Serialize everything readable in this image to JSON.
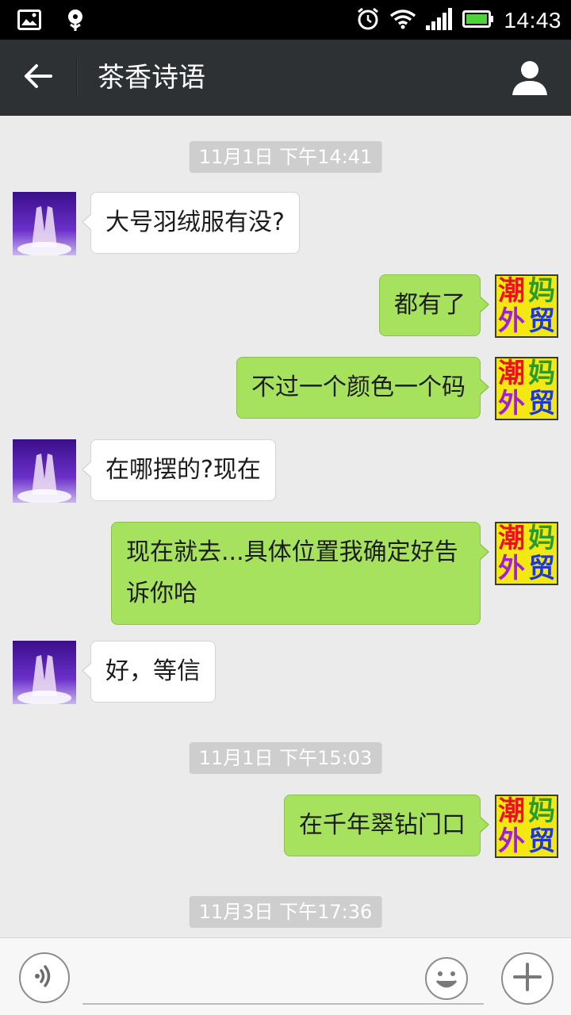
{
  "status_bar": {
    "time": "14:43",
    "left_icons": [
      "image-icon",
      "notification-flower-icon"
    ],
    "right_icons": [
      "alarm-icon",
      "wifi-icon",
      "signal-icon",
      "battery-icon"
    ]
  },
  "header": {
    "title": "茶香诗语",
    "back_icon": "back-arrow-icon",
    "profile_icon": "contact-profile-icon"
  },
  "timestamps": [
    "11月1日 下午14:41",
    "11月1日 下午15:03",
    "11月3日 下午17:36"
  ],
  "messages": [
    {
      "direction": "in",
      "text": "大号羽绒服有没?"
    },
    {
      "direction": "out",
      "text": "都有了"
    },
    {
      "direction": "out",
      "text": "不过一个颜色一个码"
    },
    {
      "direction": "in",
      "text": "在哪摆的?现在"
    },
    {
      "direction": "out",
      "text": "现在就去...具体位置我确定好告诉你哈"
    },
    {
      "direction": "in",
      "text": "好，等信"
    },
    {
      "direction": "out",
      "text": "在千年翠钻门口"
    }
  ],
  "sender_logo": {
    "chars": [
      "潮",
      "妈",
      "外",
      "贸"
    ],
    "colors": [
      "#e8141c",
      "#2a9a2a",
      "#a020d8",
      "#1e38d8"
    ],
    "background": "#f4e813"
  },
  "colors": {
    "outgoing_bubble": "#a6e25e",
    "incoming_bubble": "#ffffff",
    "header_bg": "#2d3133",
    "chat_bg": "#ebebeb"
  },
  "input_bar": {
    "placeholder": "",
    "voice_icon": "voice-icon",
    "emoji_icon": "emoji-icon",
    "plus_icon": "plus-icon"
  }
}
